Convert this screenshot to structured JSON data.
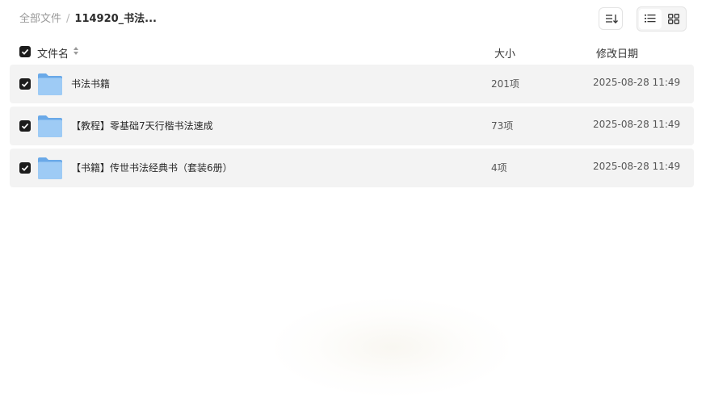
{
  "breadcrumb": {
    "root": "全部文件",
    "separator": "/",
    "current": "114920_书法..."
  },
  "toolbar": {
    "sort_icon": "sort-descending-icon",
    "view_list_icon": "list-view-icon",
    "view_grid_icon": "grid-view-icon",
    "active_view": "list"
  },
  "table": {
    "columns": {
      "name": "文件名",
      "size": "大小",
      "date": "修改日期"
    },
    "rows": [
      {
        "name": "书法书籍",
        "size": "201项",
        "date": "2025-08-28 11:49",
        "checked": true,
        "icon": "folder-icon"
      },
      {
        "name": "【教程】零基础7天行楷书法速成",
        "size": "73项",
        "date": "2025-08-28 11:49",
        "checked": true,
        "icon": "folder-icon"
      },
      {
        "name": "【书籍】传世书法经典书（套装6册）",
        "size": "4项",
        "date": "2025-08-28 11:49",
        "checked": true,
        "icon": "folder-icon"
      }
    ]
  },
  "colors": {
    "row_background": "#f3f3f3",
    "checkbox": "#1c1c1c",
    "folder_light": "#9ecbf5",
    "folder_dark": "#6aa9e8"
  }
}
